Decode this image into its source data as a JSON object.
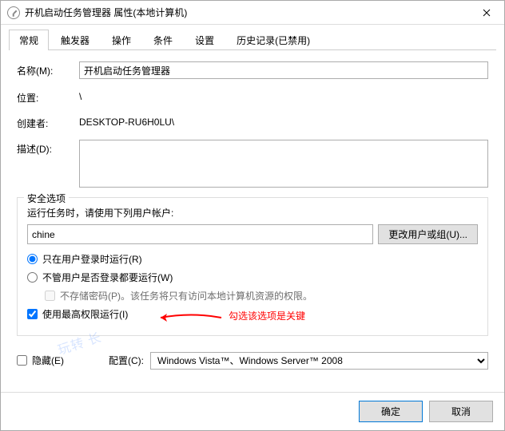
{
  "window": {
    "title": "开机启动任务管理器 属性(本地计算机)"
  },
  "tabs": {
    "general": "常规",
    "triggers": "触发器",
    "actions": "操作",
    "conditions": "条件",
    "settings": "设置",
    "history": "历史记录(已禁用)"
  },
  "fields": {
    "name_label": "名称(M):",
    "name_value": "开机启动任务管理器",
    "location_label": "位置:",
    "location_value": "\\",
    "creator_label": "创建者:",
    "creator_value": "DESKTOP-RU6H0LU\\",
    "description_label": "描述(D):",
    "description_value": ""
  },
  "security": {
    "legend": "安全选项",
    "account_hint": "运行任务时，请使用下列用户帐户:",
    "account_value": "chine",
    "change_btn": "更改用户或组(U)...",
    "radio_logged_on": "只在用户登录时运行(R)",
    "radio_any": "不管用户是否登录都要运行(W)",
    "no_store_pwd": "不存储密码(P)。该任务将只有访问本地计算机资源的权限。",
    "highest_priv": "使用最高权限运行(I)"
  },
  "bottom": {
    "hidden": "隐藏(E)",
    "config_label": "配置(C):",
    "config_value": "Windows Vista™、Windows Server™ 2008"
  },
  "footer": {
    "ok": "确定",
    "cancel": "取消"
  },
  "annotation": {
    "text": "勾选该选项是关键"
  },
  "watermark": "玩转          长"
}
